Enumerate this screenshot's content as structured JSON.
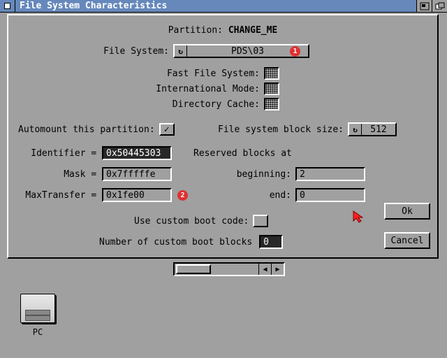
{
  "titlebar": {
    "text": "File System Characteristics"
  },
  "dialog": {
    "partition_label": "Partition: ",
    "partition_value": "CHANGE_ME",
    "filesystem_label": "File System:",
    "filesystem_value": "PDS\\03",
    "fast_fs_label": "Fast File System:",
    "intl_label": "International Mode:",
    "dcache_label": "Directory Cache:",
    "automount_label": "Automount this partition:",
    "automount_checked": "✓",
    "blocksize_label": "File system block size:",
    "blocksize_value": "512",
    "identifier_label": "Identifier = ",
    "identifier_value": "0x50445303",
    "mask_label": "Mask = ",
    "mask_value": "0x7fffffe",
    "maxtransfer_label": "MaxTransfer = ",
    "maxtransfer_value": "0x1fe00",
    "reserved_label": "Reserved blocks at",
    "beginning_label": "beginning:",
    "beginning_value": "2",
    "end_label": "end:",
    "end_value": "0",
    "customboot_label": "Use custom boot code:",
    "bootblocks_label": "Number of custom boot blocks",
    "bootblocks_value": "0",
    "ok_label": "Ok",
    "cancel_label": "Cancel",
    "badge1": "1",
    "badge2": "2"
  },
  "desktop": {
    "disk_label": "PC"
  }
}
